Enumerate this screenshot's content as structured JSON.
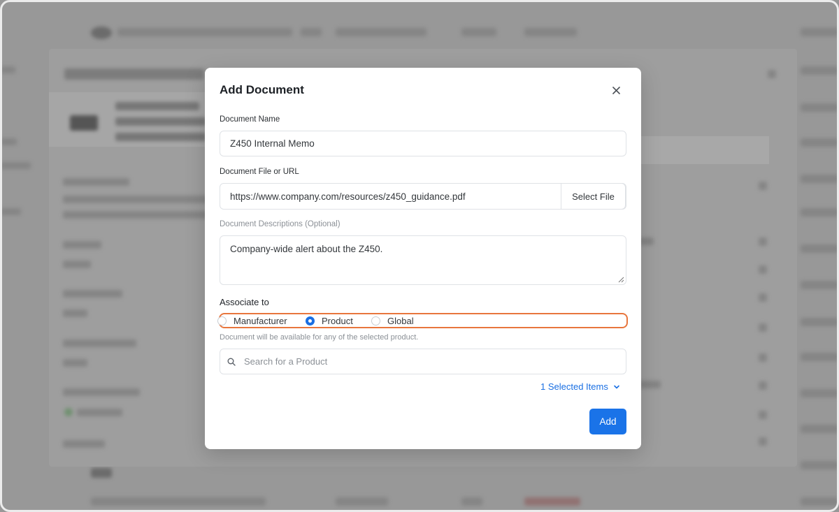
{
  "modal": {
    "title": "Add Document",
    "document_name": {
      "label": "Document Name",
      "value": "Z450 Internal Memo"
    },
    "document_file": {
      "label": "Document File or URL",
      "value": "https://www.company.com/resources/z450_guidance.pdf",
      "button_label": "Select File"
    },
    "description": {
      "label": "Document Descriptions (Optional)",
      "value": "Company-wide alert about the Z450."
    },
    "associate": {
      "label": "Associate to",
      "options": [
        "Manufacturer",
        "Product",
        "Global"
      ],
      "selected": "Product",
      "hint": "Document will be available for any of the selected product."
    },
    "search": {
      "placeholder": "Search for a Product"
    },
    "selected_items_label": "1 Selected Items",
    "add_label": "Add"
  },
  "colors": {
    "accent": "#1a73e8",
    "highlight": "#e8763d"
  }
}
